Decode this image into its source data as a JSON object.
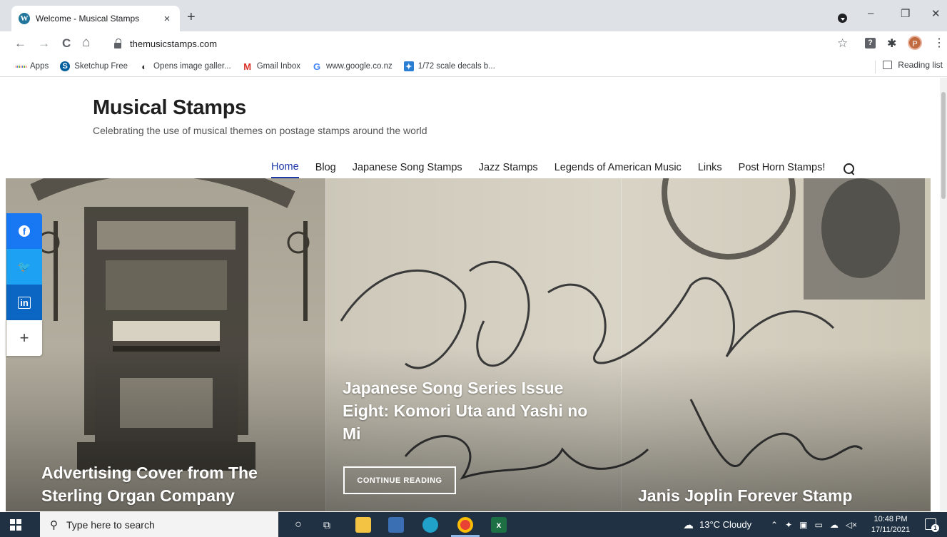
{
  "browser": {
    "tab": {
      "title": "Welcome - Musical Stamps",
      "favicon": "W"
    },
    "new_tab_label": "+",
    "window_controls": {
      "minimize": "–",
      "restore": "❐",
      "close": "✕"
    },
    "nav": {
      "back": "←",
      "forward": "→",
      "reload": "C",
      "home": "⌂"
    },
    "url": "themusicstamps.com",
    "star": "☆",
    "ext1": "?",
    "ext2": "✱",
    "avatar": "P",
    "menu": "⋮",
    "bookmarks": [
      {
        "label": "Apps",
        "icon": "apps-grid-icon"
      },
      {
        "label": "Sketchup Free",
        "icon": "sketchup-icon",
        "glyph": "S"
      },
      {
        "label": "Opens image galler...",
        "icon": "image-gallery-icon",
        "glyph": "◐"
      },
      {
        "label": "Gmail Inbox",
        "icon": "gmail-icon",
        "glyph": "M"
      },
      {
        "label": "www.google.co.nz",
        "icon": "google-icon",
        "glyph": "G"
      },
      {
        "label": "1/72 scale decals b...",
        "icon": "decals-icon",
        "glyph": "✦"
      }
    ],
    "reading_list": "Reading list"
  },
  "site": {
    "title": "Musical Stamps",
    "tagline": "Celebrating the use of musical themes on postage stamps around the world",
    "nav": [
      "Home",
      "Blog",
      "Japanese Song Stamps",
      "Jazz Stamps",
      "Legends of American Music",
      "Links",
      "Post Horn Stamps!"
    ]
  },
  "hero": {
    "handwriting": [
      "Wm Canfield Esq",
      "Canaan Valley"
    ],
    "cards": [
      {
        "title": "Advertising Cover from The Sterling Organ Company"
      },
      {
        "title": "Japanese Song Series Issue Eight: Komori Uta and Yashi no Mi",
        "button": "CONTINUE READING"
      },
      {
        "title": "Janis Joplin Forever Stamp"
      }
    ],
    "share": {
      "facebook": "f",
      "twitter": "🐦",
      "linkedin": "in",
      "more": "+"
    }
  },
  "taskbar": {
    "search_placeholder": "Type here to search",
    "weather": "13°C  Cloudy",
    "time": "10:48 PM",
    "date": "17/11/2021",
    "notifications": "1"
  },
  "colors": {
    "accent_nav": "#1d39a5",
    "facebook": "#1877f2",
    "twitter": "#1da1f2",
    "linkedin": "#0a66c2",
    "taskbar": "#1f3142"
  }
}
